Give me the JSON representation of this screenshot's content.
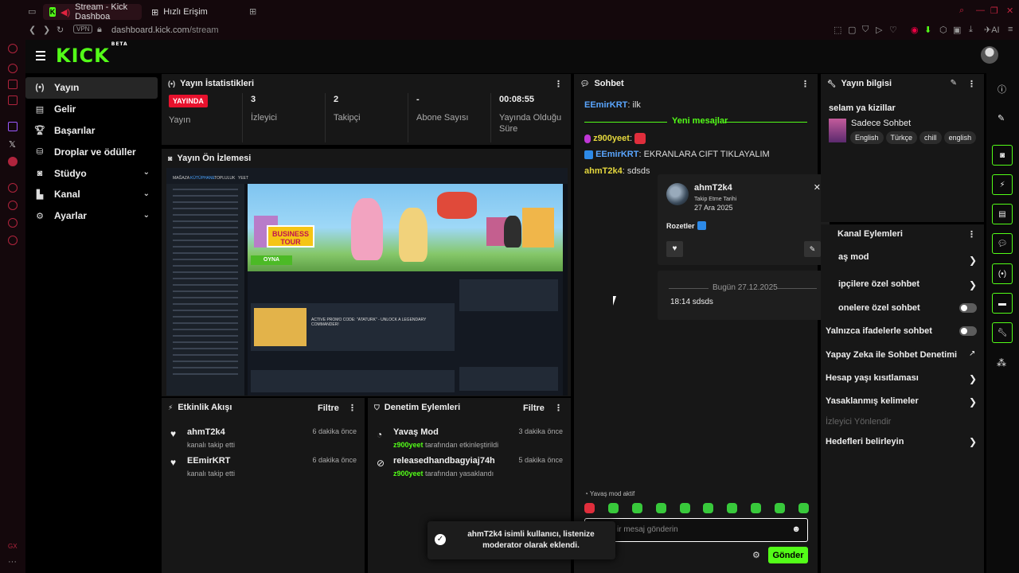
{
  "browser": {
    "tabs": [
      {
        "label": "Stream - Kick Dashboa"
      },
      {
        "label": "Hızlı Erişim"
      }
    ],
    "url_host": "dashboard.kick.com",
    "url_path": "/stream",
    "vpn": "VPN",
    "ai": "AI"
  },
  "app": {
    "logo": "KICK",
    "logo_badge": "BETA"
  },
  "nav": {
    "items": [
      {
        "label": "Yayın",
        "icon": "broadcast-icon"
      },
      {
        "label": "Gelir",
        "icon": "revenue-icon"
      },
      {
        "label": "Başarılar",
        "icon": "trophy-icon"
      },
      {
        "label": "Droplar ve ödüller",
        "icon": "drops-icon"
      },
      {
        "label": "Stüdyo",
        "icon": "studio-icon"
      },
      {
        "label": "Kanal",
        "icon": "channel-icon"
      },
      {
        "label": "Ayarlar",
        "icon": "gear-icon"
      }
    ]
  },
  "stats": {
    "title": "Yayın İstatistikleri",
    "live_badge": "YAYINDA",
    "items": [
      {
        "value": "",
        "label": "Yayın"
      },
      {
        "value": "3",
        "label": "İzleyici"
      },
      {
        "value": "2",
        "label": "Takipçi"
      },
      {
        "value": "-",
        "label": "Abone Sayısı"
      },
      {
        "value": "00:08:55",
        "label": "Yayında Olduğu Süre"
      }
    ]
  },
  "preview": {
    "title": "Yayın Ön İzlemesi",
    "menu": [
      "MAĞAZA",
      "KÜTÜPHANE",
      "TOPLULUK",
      "YEET"
    ],
    "banner_sign": "BUSINESS TOUR",
    "play": "OYNA",
    "news_title": "ACTIVE PROMO CODE: \"ATATURK\" - UNLOCK A LEGENDARY COMMANDER!"
  },
  "activity": {
    "title": "Etkinlik Akışı",
    "filter": "Filtre",
    "items": [
      {
        "name": "ahmT2k4",
        "sub": "kanalı takip etti",
        "time": "6 dakika önce"
      },
      {
        "name": "EEmirKRT",
        "sub": "kanalı takip etti",
        "time": "6 dakika önce"
      }
    ]
  },
  "moderation": {
    "title": "Denetim Eylemleri",
    "filter": "Filtre",
    "items": [
      {
        "name": "Yavaş Mod",
        "by": "z900yeet",
        "sub": "tarafından etkinleştirildi",
        "time": "3 dakika önce"
      },
      {
        "name": "releasedhandbagyiaj74h",
        "by": "z900yeet",
        "sub": "tarafından yasaklandı",
        "time": "5 dakika önce"
      }
    ]
  },
  "chat": {
    "title": "Sohbet",
    "messages": [
      {
        "user": "EEmirKRT",
        "text": ": ilk"
      },
      {
        "user": "z900yeet",
        "text": ":"
      },
      {
        "user": "EEmirKRT",
        "text": ": EKRANLARA CIFT TIKLAYALIM"
      },
      {
        "user": "ahmT2k4",
        "text": ": sdsds"
      }
    ],
    "new_messages": "Yeni mesajlar",
    "slow_mode": "Yavaş mod aktif",
    "input_placeholder": "ir mesaj gönderin",
    "send": "Gönder"
  },
  "usercard": {
    "name": "ahmT2k4",
    "follow_label": "Takip Etme Tarihi",
    "follow_date": "27 Ara 2025",
    "badges_label": "Rozetler",
    "date_divider": "Bugün 27.12.2025",
    "message": "18:14 sdsds"
  },
  "toast": {
    "text": "ahmT2k4 isimli kullanıcı, listenize moderator olarak eklendi."
  },
  "info": {
    "title": "Yayın bilgisi",
    "stream_title": "selam ya kizillar",
    "category": "Sadece Sohbet",
    "tags": [
      "English",
      "Türkçe",
      "chill",
      "english"
    ]
  },
  "channel_actions": {
    "title": "Kanal Eylemleri",
    "items": [
      {
        "label": "aş mod",
        "kind": "chevron"
      },
      {
        "label": "ipçilere özel sohbet",
        "kind": "chevron"
      },
      {
        "label": "onelere özel sohbet",
        "kind": "toggle"
      },
      {
        "label": "Yalnızca ifadelerle sohbet",
        "kind": "toggle"
      },
      {
        "label": "Yapay Zeka ile Sohbet Denetimi",
        "kind": "external"
      },
      {
        "label": "Hesap yaşı kısıtlaması",
        "kind": "chevron"
      },
      {
        "label": "Yasaklanmış kelimeler",
        "kind": "chevron"
      },
      {
        "label": "İzleyici Yönlendir",
        "kind": "disabled"
      },
      {
        "label": "Hedefleri belirleyin",
        "kind": "chevron"
      }
    ]
  },
  "colors": {
    "accent": "#53fc18",
    "live": "#e8112d",
    "opera": "#b0243d"
  }
}
